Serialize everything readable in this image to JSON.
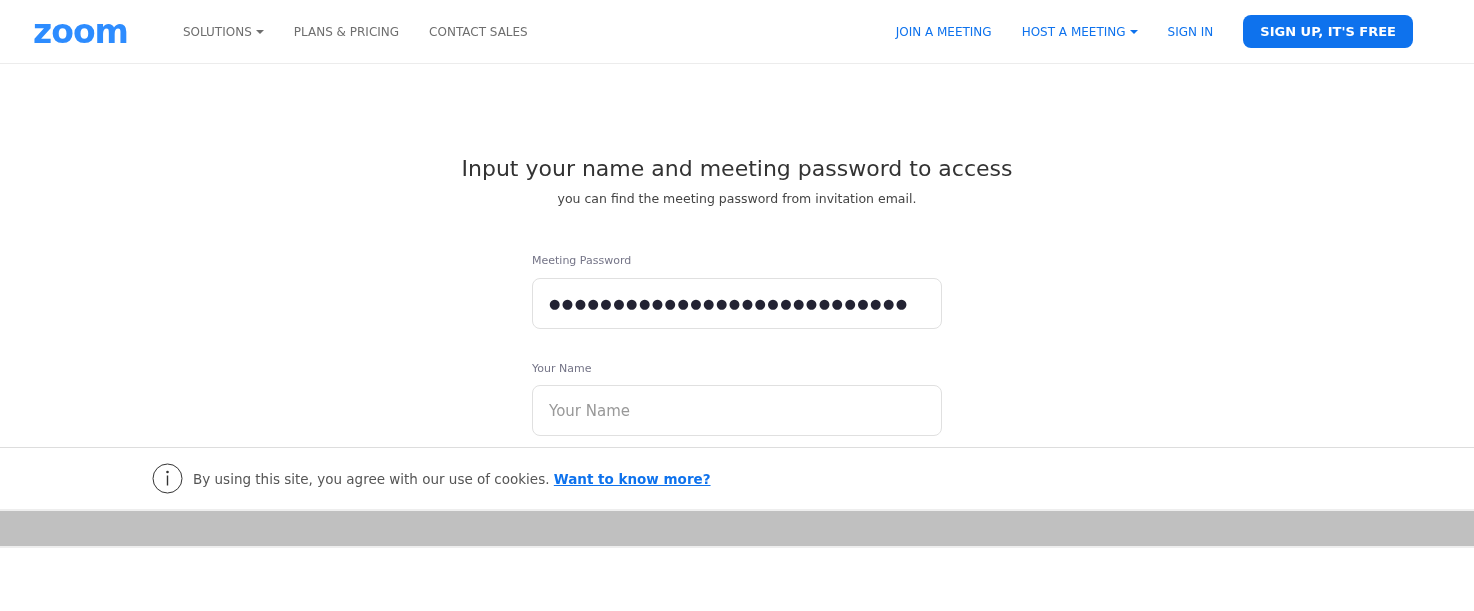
{
  "header": {
    "logo": "zoom",
    "nav_left": [
      {
        "label": "SOLUTIONS",
        "dropdown": true
      },
      {
        "label": "PLANS & PRICING",
        "dropdown": false
      },
      {
        "label": "CONTACT SALES",
        "dropdown": false
      }
    ],
    "nav_right": [
      {
        "label": "JOIN A MEETING",
        "dropdown": false
      },
      {
        "label": "HOST A MEETING",
        "dropdown": true
      },
      {
        "label": "SIGN IN",
        "dropdown": false
      }
    ],
    "signup_button": "SIGN UP, IT'S FREE"
  },
  "form": {
    "title": "Input your name and meeting password to access",
    "subtitle": "you can find the meeting password from invitation email.",
    "fields": [
      {
        "label": "Meeting Password",
        "value": "●●●●●●●●●●●●●●●●●●●●●●●●●●●●"
      },
      {
        "label": "Your Name",
        "placeholder": "Your Name"
      }
    ]
  },
  "cookie_banner": {
    "text": "By using this site, you agree with our use of cookies.",
    "link": "Want to know more?"
  }
}
